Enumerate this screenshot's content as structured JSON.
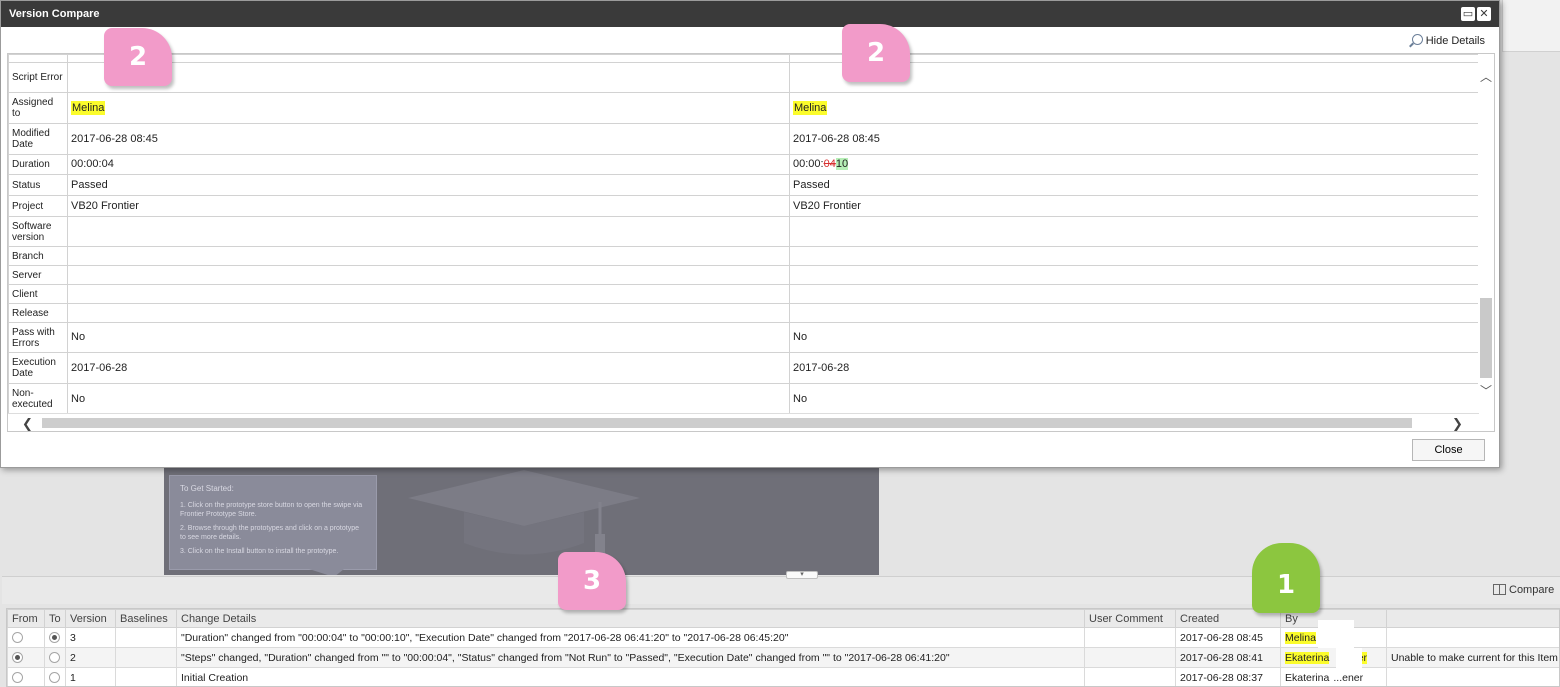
{
  "dialog": {
    "title": "Version Compare",
    "hide_details_label": "Hide Details",
    "close_label": "Close",
    "rows": [
      {
        "label": "Script Error",
        "v1": "",
        "v2": ""
      },
      {
        "label": "Assigned to",
        "v1": "Melina",
        "v2": "Melina"
      },
      {
        "label": "Modified Date",
        "v1": "2017-06-28 08:45",
        "v2": "2017-06-28 08:45"
      },
      {
        "label": "Duration",
        "v1": "00:00:04",
        "v2_prefix": "00:00:",
        "v2_removed": "04",
        "v2_added": "10"
      },
      {
        "label": "Status",
        "v1": "Passed",
        "v2": "Passed"
      },
      {
        "label": "Project",
        "v1": "VB20 Frontier",
        "v2": "VB20 Frontier"
      },
      {
        "label": "Software version",
        "v1": "",
        "v2": ""
      },
      {
        "label": "Branch",
        "v1": "",
        "v2": ""
      },
      {
        "label": "Server",
        "v1": "",
        "v2": ""
      },
      {
        "label": "Client",
        "v1": "",
        "v2": ""
      },
      {
        "label": "Release",
        "v1": "",
        "v2": ""
      },
      {
        "label": "Pass with Errors",
        "v1": "No",
        "v2": "No"
      },
      {
        "label": "Execution Date",
        "v1": "2017-06-28",
        "v2": "2017-06-28"
      },
      {
        "label": "Non-executed",
        "v1": "No",
        "v2": "No"
      }
    ]
  },
  "background": {
    "get_started_title": "To Get Started:",
    "steps": [
      "1.  Click on the prototype store button to open the swipe via Frontier Prototype Store.",
      "2.  Browse through the prototypes and click on a prototype to see more details.",
      "3.  Click on the Install button to install the prototype."
    ]
  },
  "history": {
    "compare_label": "Compare",
    "columns": [
      "From",
      "To",
      "Version",
      "Baselines",
      "Change Details",
      "User Comment",
      "Created",
      "By",
      ""
    ],
    "rows": [
      {
        "version": "3",
        "baselines": "",
        "details": "\"Duration\" changed from \"00:00:04\" to \"00:00:10\", \"Execution Date\" changed from \"2017-06-28 06:41:20\" to \"2017-06-28 06:45:20\"",
        "comment": "",
        "created": "2017-06-28 08:45",
        "by": "Melina",
        "note": ""
      },
      {
        "version": "2",
        "baselines": "",
        "details": "\"Steps\" changed, \"Duration\" changed from \"\" to \"00:00:04\", \"Status\" changed from \"Not Run\" to \"Passed\", \"Execution Date\" changed from \"\" to \"2017-06-28 06:41:20\"",
        "comment": "",
        "created": "2017-06-28 08:41",
        "by": "Ekaterina",
        "by_suffix": "ier",
        "note": "Unable to make current for this Item"
      },
      {
        "version": "1",
        "baselines": "",
        "details": "Initial Creation",
        "comment": "",
        "created": "2017-06-28 08:37",
        "by": "Ekaterina",
        "by_suffix": "...ener",
        "note": ""
      }
    ]
  },
  "markers": {
    "m1": "1",
    "m2a": "2",
    "m2b": "2",
    "m3": "3"
  },
  "colors": {
    "highlight": "#fbfc2c",
    "marker_pink": "#f29bc9",
    "marker_green": "#8cc63f",
    "titlebar": "#3a3a3a"
  }
}
